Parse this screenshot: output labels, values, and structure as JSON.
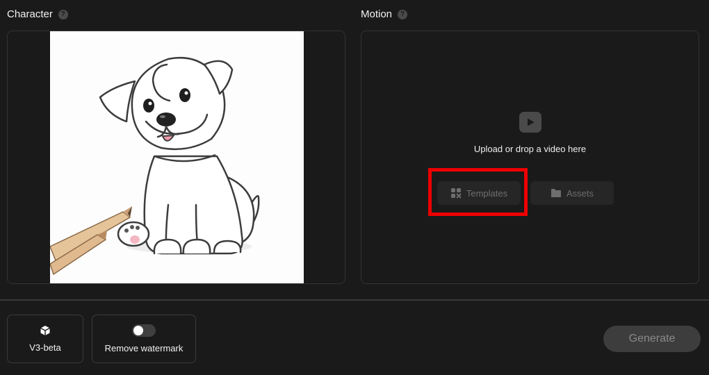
{
  "character": {
    "title": "Character",
    "help_icon": "question-circle-icon"
  },
  "motion": {
    "title": "Motion",
    "help_icon": "question-circle-icon",
    "upload_icon": "play-icon",
    "upload_text": "Upload or drop a video here",
    "templates_label": "Templates",
    "templates_icon": "templates-grid-icon",
    "assets_label": "Assets",
    "assets_icon": "folder-icon"
  },
  "options": {
    "model_label": "V3-beta",
    "model_icon": "cube-icon",
    "watermark_label": "Remove watermark",
    "watermark_enabled": false
  },
  "actions": {
    "generate_label": "Generate"
  },
  "colors": {
    "background": "#1a1a1a",
    "panel_border": "#333333",
    "highlight": "#ee0000",
    "disabled_text": "#6e6e6e"
  }
}
